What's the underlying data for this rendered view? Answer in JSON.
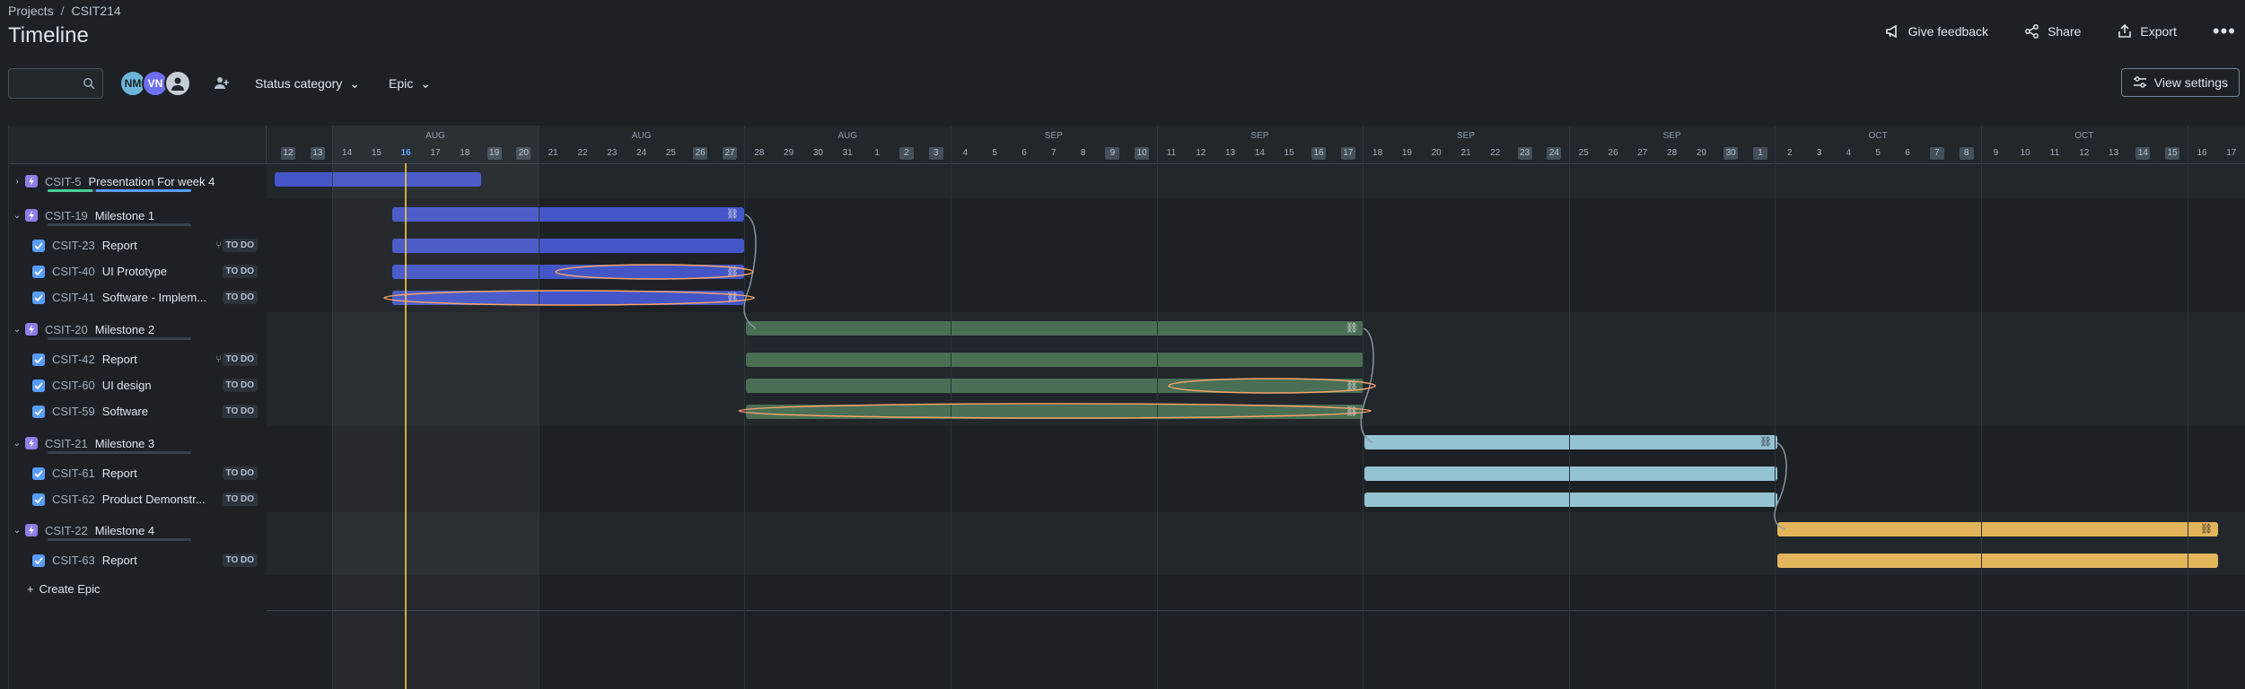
{
  "breadcrumb": {
    "projects": "Projects",
    "separator": "/",
    "project": "CSIT214"
  },
  "page_title": "Timeline",
  "header_actions": {
    "feedback": "Give feedback",
    "share": "Share",
    "export": "Export"
  },
  "toolbar": {
    "search_placeholder": "",
    "avatars": [
      "NM",
      "VN",
      ""
    ],
    "status_filter": "Status category",
    "epic_filter": "Epic",
    "view_settings": "View settings"
  },
  "months": [
    {
      "label": "AUG"
    },
    {
      "label": "AUG"
    },
    {
      "label": "AUG"
    },
    {
      "label": "SEP"
    },
    {
      "label": "SEP"
    },
    {
      "label": "SEP"
    },
    {
      "label": "SEP"
    },
    {
      "label": "OCT"
    },
    {
      "label": "OCT"
    }
  ],
  "days": [
    "12",
    "13",
    "14",
    "15",
    "16",
    "17",
    "18",
    "19",
    "20",
    "21",
    "22",
    "23",
    "24",
    "25",
    "26",
    "27",
    "28",
    "29",
    "30",
    "31",
    "1",
    "2",
    "3",
    "4",
    "5",
    "6",
    "7",
    "8",
    "9",
    "10",
    "11",
    "12",
    "13",
    "14",
    "15",
    "16",
    "17",
    "18",
    "19",
    "20",
    "21",
    "22",
    "23",
    "24",
    "25",
    "26",
    "27",
    "28",
    "29",
    "30",
    "1",
    "2",
    "3",
    "4",
    "5",
    "6",
    "7",
    "8",
    "9",
    "10",
    "11",
    "12",
    "13",
    "14",
    "15",
    "16",
    "17"
  ],
  "weekend_days": [
    0,
    1,
    7,
    8,
    14,
    15,
    21,
    22,
    28,
    29,
    35,
    36,
    42,
    43,
    49,
    50,
    56,
    57,
    63,
    64
  ],
  "today_index": 4,
  "rows": {
    "epic_5": {
      "key": "CSIT-5",
      "summary": "Presentation For week 4"
    },
    "epic_19": {
      "key": "CSIT-19",
      "summary": "Milestone 1"
    },
    "task_23": {
      "key": "CSIT-23",
      "summary": "Report",
      "status": "TO DO"
    },
    "task_40": {
      "key": "CSIT-40",
      "summary": "UI Prototype",
      "status": "TO DO"
    },
    "task_41": {
      "key": "CSIT-41",
      "summary": "Software - Implem...",
      "status": "TO DO"
    },
    "epic_20": {
      "key": "CSIT-20",
      "summary": "Milestone 2"
    },
    "task_42": {
      "key": "CSIT-42",
      "summary": "Report",
      "status": "TO DO"
    },
    "task_60": {
      "key": "CSIT-60",
      "summary": "UI design",
      "status": "TO DO"
    },
    "task_59": {
      "key": "CSIT-59",
      "summary": "Software",
      "status": "TO DO"
    },
    "epic_21": {
      "key": "CSIT-21",
      "summary": "Milestone 3"
    },
    "task_61": {
      "key": "CSIT-61",
      "summary": "Report",
      "status": "TO DO"
    },
    "task_62": {
      "key": "CSIT-62",
      "summary": "Product Demonstr...",
      "status": "TO DO"
    },
    "epic_22": {
      "key": "CSIT-22",
      "summary": "Milestone 4"
    },
    "task_63": {
      "key": "CSIT-63",
      "summary": "Report",
      "status": "TO DO"
    }
  },
  "create_epic": "Create Epic",
  "colors": {
    "milestone1": "#4456c7",
    "milestone2": "#4a6f54",
    "milestone3": "#94c3d2",
    "milestone4": "#e3b55b"
  }
}
